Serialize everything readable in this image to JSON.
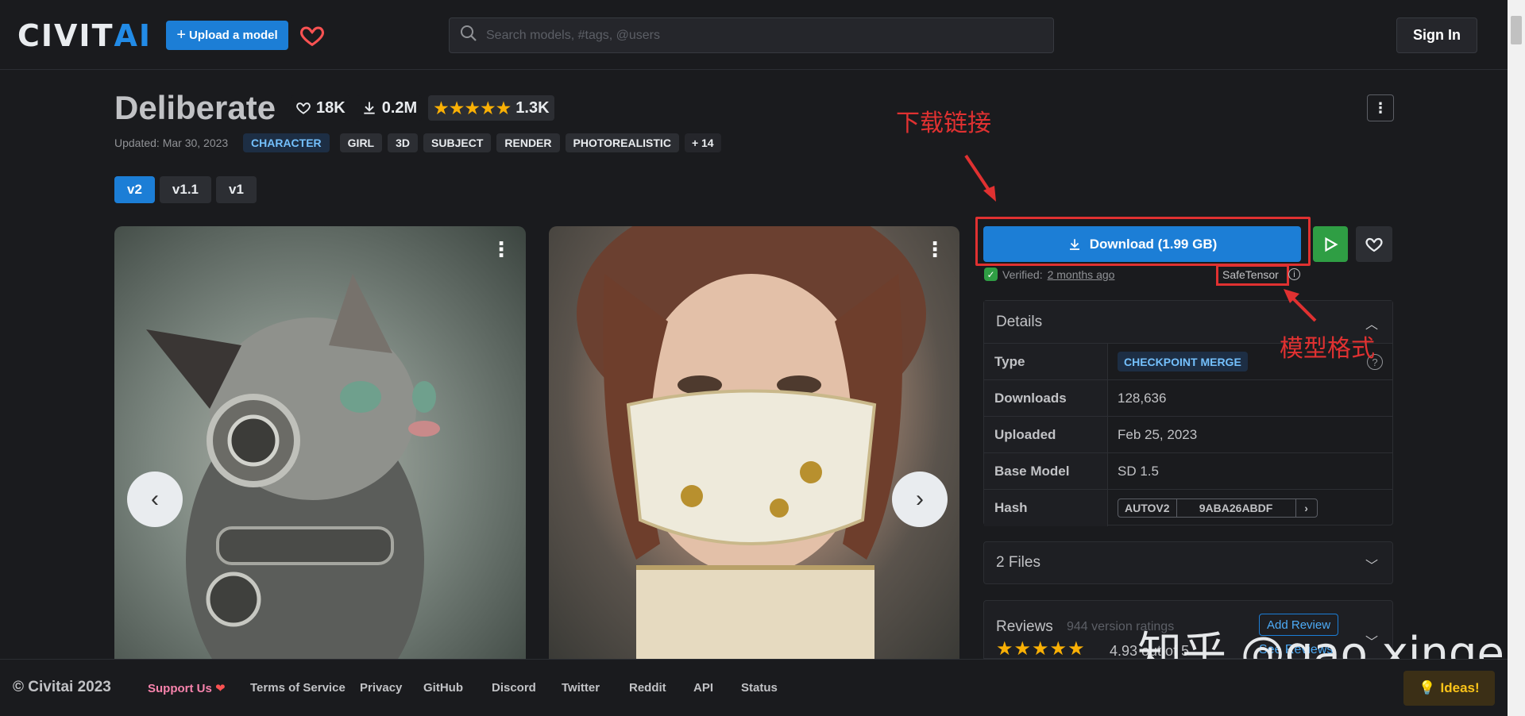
{
  "header": {
    "logo_civit": "CIVIT",
    "logo_ai": "AI",
    "upload_label": "Upload a model",
    "search_placeholder": "Search models, #tags, @users",
    "signin_label": "Sign In"
  },
  "model": {
    "title": "Deliberate",
    "likes": "18K",
    "downloads": "0.2M",
    "rating_count": "1.3K",
    "rating_stars": 5,
    "updated": "Updated: Mar 30, 2023",
    "category_tag": "CHARACTER",
    "tags": [
      "GIRL",
      "3D",
      "SUBJECT",
      "RENDER",
      "PHOTOREALISTIC"
    ],
    "more_tags": "+ 14",
    "versions": [
      "v2",
      "v1.1",
      "v1"
    ],
    "active_version": "v2"
  },
  "download": {
    "label": "Download (1.99 GB)",
    "verified_prefix": "Verified:",
    "verified_time": "2 months ago",
    "format": "SafeTensor"
  },
  "details": {
    "heading": "Details",
    "rows": {
      "type_label": "Type",
      "type_value": "CHECKPOINT MERGE",
      "downloads_label": "Downloads",
      "downloads_value": "128,636",
      "uploaded_label": "Uploaded",
      "uploaded_value": "Feb 25, 2023",
      "base_label": "Base Model",
      "base_value": "SD 1.5",
      "hash_label": "Hash",
      "hash_type": "AUTOV2",
      "hash_value": "9ABA26ABDF"
    }
  },
  "files": {
    "label": "2 Files"
  },
  "reviews": {
    "title": "Reviews",
    "version_ratings": "944 version ratings",
    "add_label": "Add Review",
    "score": "4.93 out of 5",
    "see_label": "See Reviews"
  },
  "annotations": {
    "download_link": "下载链接",
    "model_format": "模型格式",
    "watermark": "知乎 @gao xinge"
  },
  "footer": {
    "copyright": "© Civitai 2023",
    "support": "Support Us",
    "terms": "Terms of Service",
    "privacy": "Privacy",
    "github": "GitHub",
    "discord": "Discord",
    "twitter": "Twitter",
    "reddit": "Reddit",
    "api": "API",
    "status": "Status",
    "ideas": "Ideas!"
  },
  "colors": {
    "accent": "#1c7ed6",
    "annotation": "#e03131",
    "star": "#fab005",
    "run_green": "#2f9e44"
  }
}
